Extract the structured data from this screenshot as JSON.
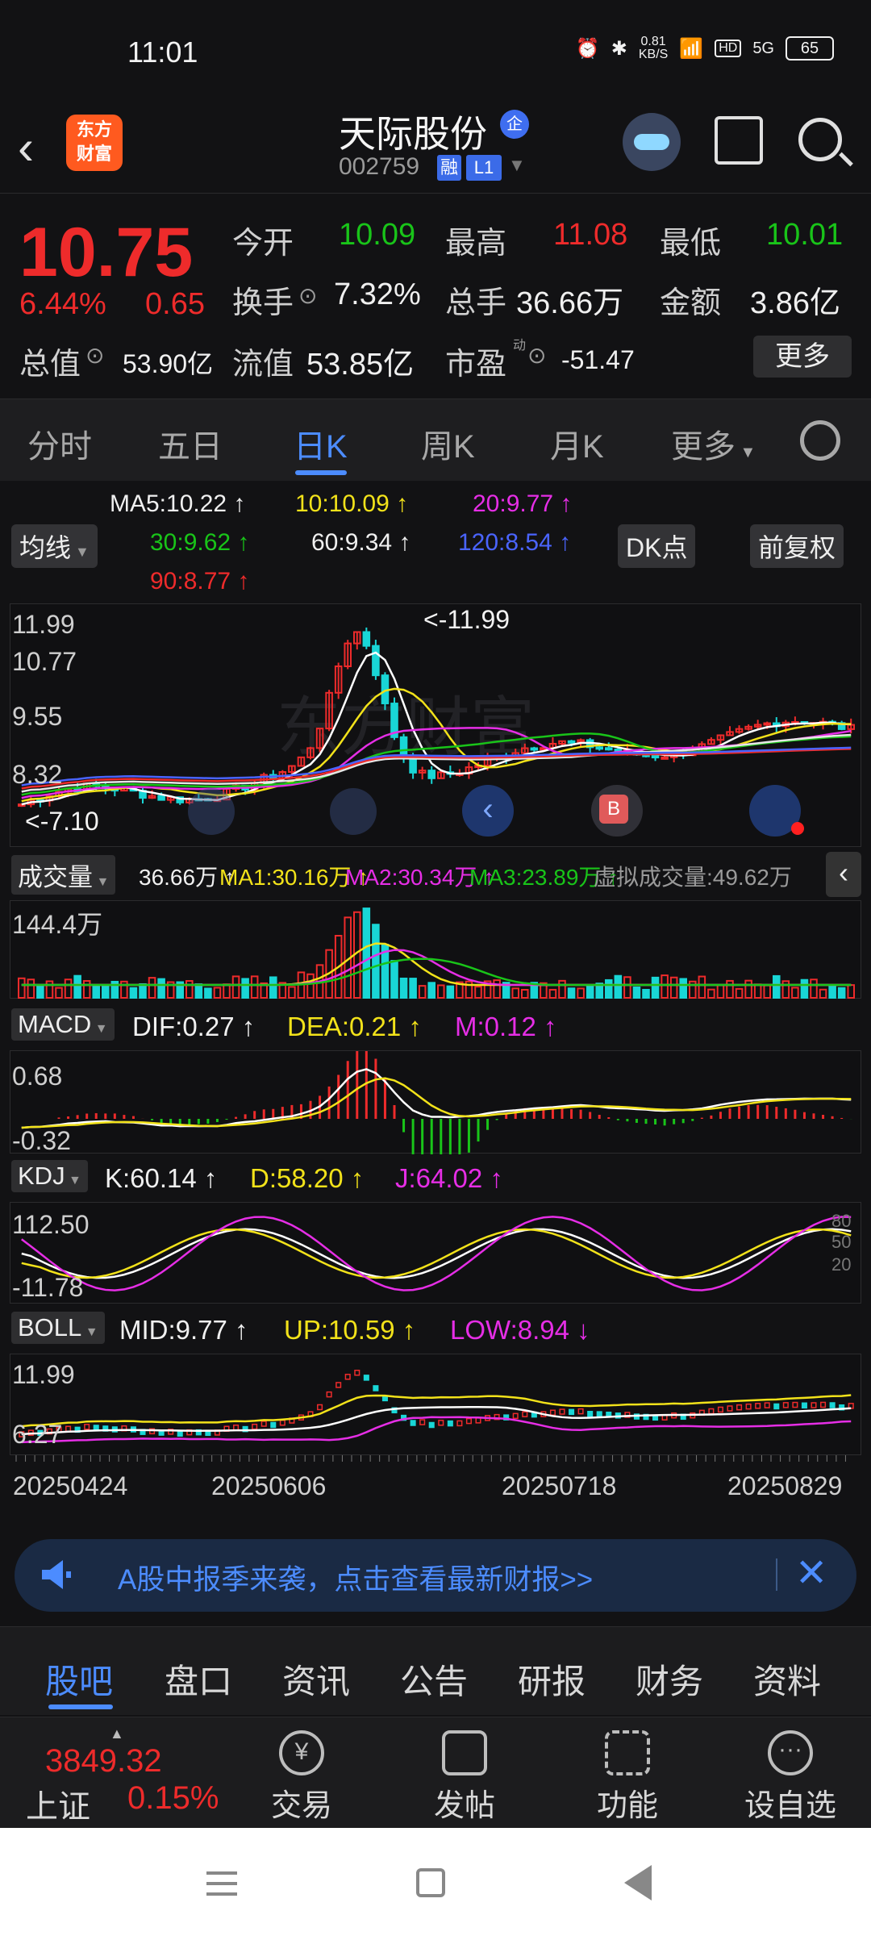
{
  "status_bar": {
    "time": "11:01",
    "net_speed": "0.81\nKB/S",
    "net_speed_top": "0.81",
    "net_speed_bottom": "KB/S",
    "signal": "5G",
    "hd": "HD",
    "battery": "65"
  },
  "header": {
    "name": "天际股份",
    "badge": "企",
    "code": "002759",
    "tag1": "融",
    "tag2": "L1",
    "logo_line1": "东方",
    "logo_line2": "财富"
  },
  "quote": {
    "price": "10.75",
    "pct": "6.44%",
    "chg": "0.65",
    "open_label": "今开",
    "open": "10.09",
    "high_label": "最高",
    "high": "11.08",
    "low_label": "最低",
    "low": "10.01",
    "turnover_label": "换手",
    "turnover": "7.32%",
    "volume_label": "总手",
    "volume": "36.66万",
    "amount_label": "金额",
    "amount": "3.86亿",
    "mcap_label": "总值",
    "mcap": "53.90亿",
    "float_label": "流值",
    "float": "53.85亿",
    "pe_label": "市盈",
    "pe_sup": "动",
    "pe": "-51.47",
    "more": "更多"
  },
  "period_tabs": [
    "分时",
    "五日",
    "日K",
    "周K",
    "月K",
    "更多"
  ],
  "ma": {
    "selector": "均线",
    "ma5": "MA5:10.22 ↑",
    "ma10": "10:10.09 ↑",
    "ma20": "20:9.77 ↑",
    "ma30": "30:9.62 ↑",
    "ma60": "60:9.34 ↑",
    "ma120": "120:8.54 ↑",
    "ma90": "90:8.77 ↑",
    "dk": "DK点",
    "fq": "前复权"
  },
  "kline": {
    "y_labels": [
      "11.99",
      "10.77",
      "9.55",
      "8.32"
    ],
    "max_marker": "<-11.99",
    "min_marker": "<-7.10",
    "watermark": "东方财富",
    "b_marker": "B"
  },
  "volume": {
    "selector": "成交量",
    "v": "36.66万 ↑",
    "ma1": "MA1:30.16万 ↑",
    "ma2": "MA2:30.34万 ↑",
    "ma3": "MA3:23.89万 ↑",
    "virtual": "虚拟成交量:49.62万",
    "y_label": "144.4万"
  },
  "macd": {
    "selector": "MACD",
    "dif": "DIF:0.27 ↑",
    "dea": "DEA:0.21 ↑",
    "m": "M:0.12 ↑",
    "y_top": "0.68",
    "y_bottom": "-0.32"
  },
  "kdj": {
    "selector": "KDJ",
    "k": "K:60.14 ↑",
    "d": "D:58.20 ↑",
    "j": "J:64.02 ↑",
    "y_top": "112.50",
    "y_bottom": "-11.78",
    "r80": "80",
    "r50": "50",
    "r20": "20"
  },
  "boll": {
    "selector": "BOLL",
    "mid": "MID:9.77 ↑",
    "up": "UP:10.59 ↑",
    "low": "LOW:8.94 ↓",
    "y_top": "11.99",
    "y_bottom": "6.27"
  },
  "dates": [
    "20250424",
    "20250606",
    "20250718",
    "20250829"
  ],
  "banner": {
    "text": "A股中报季来袭，点击查看最新财报>>"
  },
  "bottom_tabs": [
    "股吧",
    "盘口",
    "资讯",
    "公告",
    "研报",
    "财务",
    "资料"
  ],
  "index": {
    "value": "3849.32",
    "name": "上证",
    "pct": "0.15%"
  },
  "actions": [
    "交易",
    "发帖",
    "功能",
    "设自选"
  ],
  "colors": {
    "up": "#ee2b2b",
    "down": "#19c419",
    "accent": "#4c8cff"
  }
}
